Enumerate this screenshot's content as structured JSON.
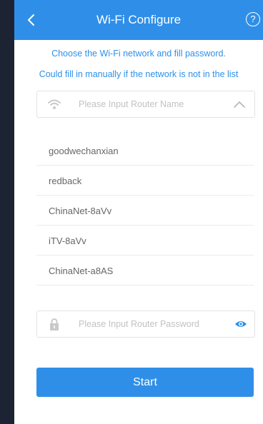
{
  "header": {
    "title": "Wi-Fi Configure",
    "help_glyph": "?"
  },
  "messages": {
    "line1": "Choose the Wi-Fi network and fill password.",
    "line2": "Could fill in manually if the network is not in the list"
  },
  "router_field": {
    "placeholder": "Please Input Router Name",
    "icon": "wifi-icon",
    "toggle_icon": "chevron-up-icon"
  },
  "networks": [
    "goodwechanxian",
    "redback",
    "ChinaNet-8aVv",
    "iTV-8aVv",
    "ChinaNet-a8AS"
  ],
  "password_field": {
    "placeholder": "Please Input Router Password",
    "icon": "lock-icon",
    "toggle_icon": "eye-icon"
  },
  "start_button": {
    "label": "Start"
  },
  "colors": {
    "accent": "#2f8fe8",
    "frame": "#1c2333"
  }
}
